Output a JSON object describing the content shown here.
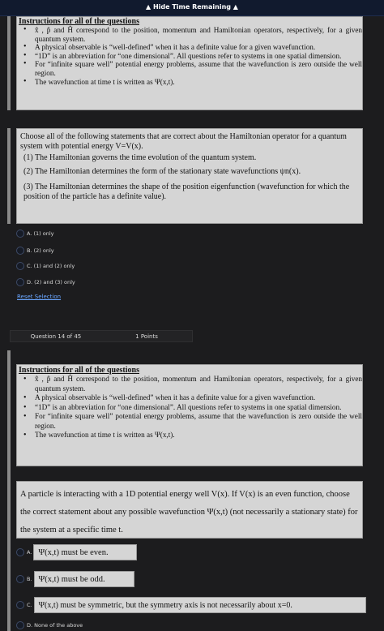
{
  "topbar": {
    "hide_label": "▲ Hide Time Remaining ▲"
  },
  "instructions": {
    "heading": "Instructions for all of the questions",
    "bullets": [
      "x̂ , p̂  and  Ĥ  correspond to the position, momentum and Hamiltonian operators, respectively, for a given quantum system.",
      "A physical observable is “well-defined” when it has a definite value for a given wavefunction.",
      "“1D” is an abbreviation for “one dimensional”. All questions refer to systems in one spatial dimension.",
      "For “infinite square well” potential energy problems, assume that the wavefunction is zero outside the well region.",
      "The wavefunction at time t is written as  Ψ(x,t)."
    ]
  },
  "question13": {
    "stem": "Choose all of the following statements that are correct about the Hamiltonian operator for a quantum system with potential energy V=V(x).",
    "statements": [
      "(1)  The Hamiltonian governs the time evolution of the quantum system.",
      "(2)  The Hamiltonian determines the form of the stationary state wavefunctions  ψn(x).",
      "(3)  The Hamiltonian determines the shape of the position eigenfunction (wavefunction for which the position of the particle has a definite value)."
    ],
    "options": [
      "A. (1) only",
      "B. (2) only",
      "C. (1) and (2) only",
      "D. (2) and (3) only"
    ],
    "reset_label": "Reset Selection"
  },
  "question_bar": {
    "number": "Question 14 of 45",
    "points": "1 Points"
  },
  "question14": {
    "stem": "A particle is interacting with a 1D potential energy well V(x). If V(x) is an even function, choose the correct statement about any possible wavefunction  Ψ(x,t)  (not necessarily a stationary state) for the system at a specific time t.",
    "options": [
      {
        "letter": "A.",
        "text": "Ψ(x,t)  must be even."
      },
      {
        "letter": "B.",
        "text": "Ψ(x,t)  must be odd."
      },
      {
        "letter": "C.",
        "text": "Ψ(x,t)  must be symmetric, but the symmetry axis is not necessarily about x=0."
      },
      {
        "letter": "",
        "text": "D. None of the above"
      }
    ]
  }
}
